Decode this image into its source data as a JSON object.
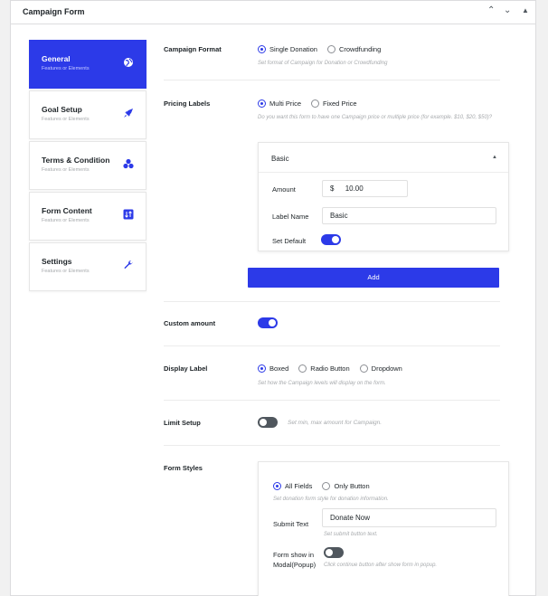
{
  "panel": {
    "title": "Campaign Form"
  },
  "tabs": [
    {
      "label": "General",
      "sub": "Features or Elements"
    },
    {
      "label": "Goal Setup",
      "sub": "Features or Elements"
    },
    {
      "label": "Terms & Condition",
      "sub": "Features or Elements"
    },
    {
      "label": "Form Content",
      "sub": "Features or Elements"
    },
    {
      "label": "Settings",
      "sub": "Features or Elements"
    }
  ],
  "campaign_format": {
    "label": "Campaign Format",
    "options": [
      "Single Donation",
      "Crowdfunding"
    ],
    "selected": "Single Donation",
    "help": "Set format of Campaign for Donation or Crowdfunding"
  },
  "pricing_labels": {
    "label": "Pricing Labels",
    "options": [
      "Multi Price",
      "Fixed Price"
    ],
    "selected": "Multi Price",
    "help": "Do you want this form to have one Campaign price or multiple price (for example. $10, $20, $50)?",
    "item": {
      "title": "Basic",
      "amount_label": "Amount",
      "currency": "$",
      "amount": "10.00",
      "name_label": "Label Name",
      "name": "Basic",
      "default_label": "Set Default",
      "default_on": true
    },
    "add_label": "Add"
  },
  "custom_amount": {
    "label": "Custom amount",
    "on": true
  },
  "display_label": {
    "label": "Display Label",
    "options": [
      "Boxed",
      "Radio Button",
      "Dropdown"
    ],
    "selected": "Boxed",
    "help": "Set how the Campaign levels will display on the form."
  },
  "limit_setup": {
    "label": "Limit Setup",
    "on": false,
    "help": "Set min, max amount for Campaign."
  },
  "form_styles": {
    "label": "Form Styles",
    "options": [
      "All Fields",
      "Only Button"
    ],
    "selected": "All Fields",
    "help": "Set donation form style for donation information.",
    "submit_label": "Submit Text",
    "submit_value": "Donate Now",
    "submit_help": "Set submit button text.",
    "popup_label_1": "Form show in",
    "popup_label_2": "Modal(Popup)",
    "popup_on": false,
    "popup_help": "Click continue button after show form in popup."
  },
  "colors": {
    "accent": "#2c3ae8"
  },
  "icons": [
    "chevron-up-icon",
    "chevron-down-icon",
    "collapse-triangle-icon",
    "globe-icon",
    "rocket-icon",
    "circles-icon",
    "sort-icon",
    "wrench-icon"
  ]
}
